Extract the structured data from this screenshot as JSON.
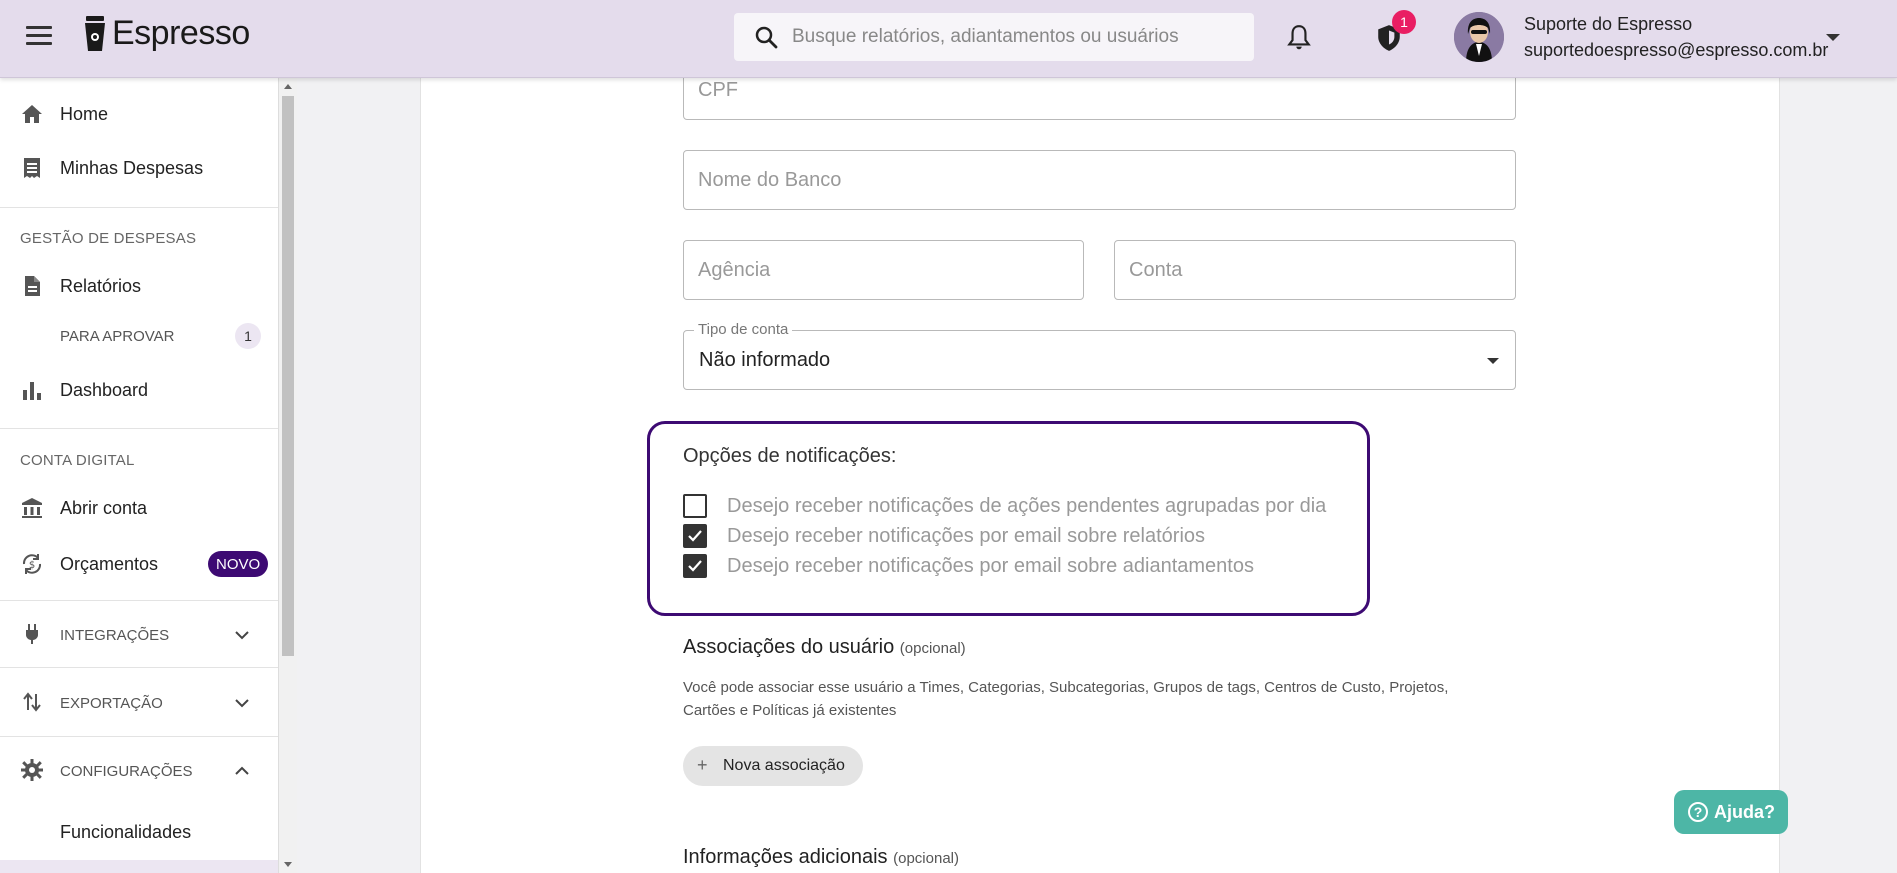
{
  "topbar": {
    "brand": "Espresso",
    "search_placeholder": "Busque relatórios, adiantamentos ou usuários",
    "shield_badge": "1",
    "user_name": "Suporte do Espresso",
    "user_email": "suportedoespresso@espresso.com.br"
  },
  "sidebar": {
    "home": "Home",
    "minhas_despesas": "Minhas Despesas",
    "section_gestao": "GESTÃO DE DESPESAS",
    "relatorios": "Relatórios",
    "para_aprovar": "PARA APROVAR",
    "para_aprovar_count": "1",
    "dashboard": "Dashboard",
    "section_conta": "CONTA DIGITAL",
    "abrir_conta": "Abrir conta",
    "orcamentos": "Orçamentos",
    "novo_badge": "NOVO",
    "integracoes": "INTEGRAÇÕES",
    "exportacao": "EXPORTAÇÃO",
    "configuracoes": "CONFIGURAÇÕES",
    "funcionalidades": "Funcionalidades"
  },
  "form": {
    "cpf_placeholder": "CPF",
    "banco_placeholder": "Nome do Banco",
    "agencia_placeholder": "Agência",
    "conta_placeholder": "Conta",
    "tipo_conta_label": "Tipo de conta",
    "tipo_conta_value": "Não informado"
  },
  "notifications": {
    "title": "Opções de notificações:",
    "options": [
      {
        "label": "Desejo receber notificações de ações pendentes agrupadas por dia",
        "checked": false
      },
      {
        "label": "Desejo receber notificações por email sobre relatórios",
        "checked": true
      },
      {
        "label": "Desejo receber notificações por email sobre adiantamentos",
        "checked": true
      }
    ]
  },
  "associations": {
    "title": "Associações do usuário",
    "optional": "(opcional)",
    "description": "Você pode associar esse usuário a Times, Categorias, Subcategorias, Grupos de tags, Centros de Custo, Projetos, Cartões e Políticas já existentes",
    "button": "Nova associação"
  },
  "additional": {
    "title": "Informações adicionais",
    "optional": "(opcional)"
  },
  "help": {
    "label": "Ajuda?"
  }
}
